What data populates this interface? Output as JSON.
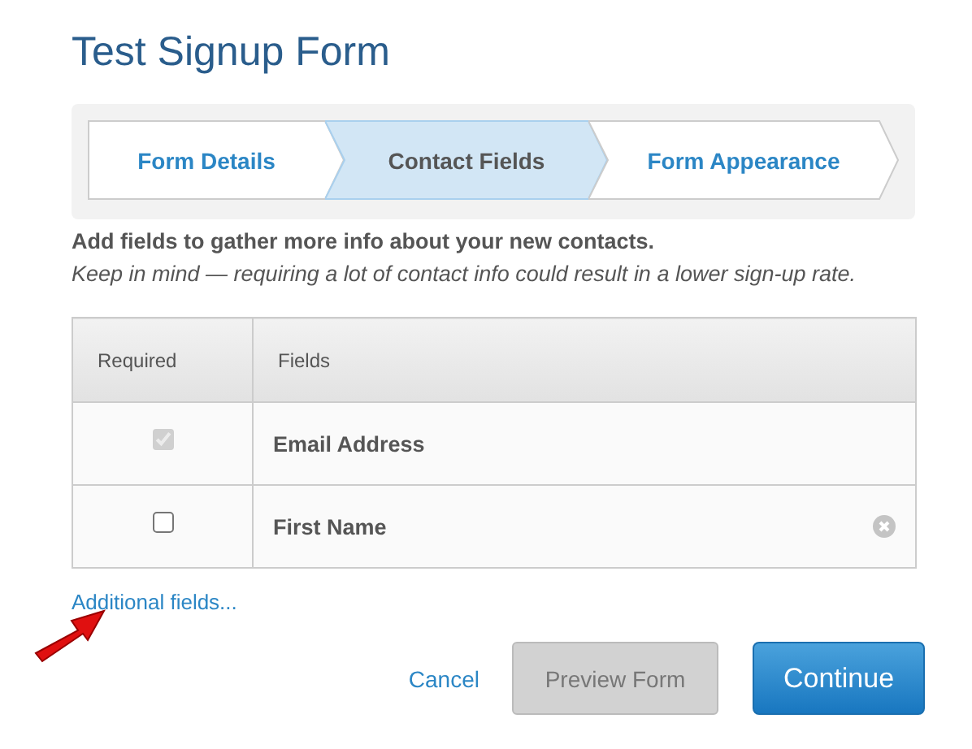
{
  "title": "Test Signup Form",
  "steps": [
    {
      "label": "Form Details",
      "selected": false
    },
    {
      "label": "Contact Fields",
      "selected": true
    },
    {
      "label": "Form Appearance",
      "selected": false
    }
  ],
  "intro": "Add fields to gather more info about your new contacts.",
  "hint": "Keep in mind — requiring a lot of contact info could result in a lower sign-up rate.",
  "table": {
    "columns": [
      "Required",
      "Fields"
    ],
    "rows": [
      {
        "name": "Email Address",
        "checked": true,
        "disabled": true,
        "removable": false
      },
      {
        "name": "First Name",
        "checked": false,
        "disabled": false,
        "removable": true
      }
    ]
  },
  "additional_link": "Additional fields...",
  "buttons": {
    "cancel": "Cancel",
    "preview": "Preview Form",
    "continue": "Continue"
  }
}
